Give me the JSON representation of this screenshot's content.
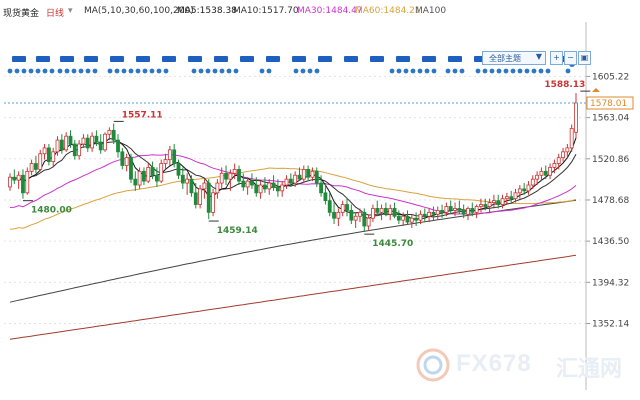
{
  "header": {
    "instrument": "现货黄金",
    "period": "日线",
    "ma_set": "MA(5,10,30,60,100,200)",
    "ma5": "MA5:1538.38",
    "ma10": "MA10:1517.70",
    "ma30": "MA30:1484.47",
    "ma60": "MA60:1484.21",
    "ma100": "MA100",
    "theme_label": "全部主题",
    "colors": {
      "period": "#cc3333",
      "ma5": "#222222",
      "ma10": "#333333",
      "ma30": "#cc33cc",
      "ma60": "#d9a23a",
      "ma100": "#555555"
    }
  },
  "watermark": {
    "brand": "FX678",
    "cn": "汇通网"
  },
  "chart_data": {
    "type": "candlestick",
    "ylim": [
      1325,
      1620
    ],
    "yticks": [
      1605.22,
      1563.04,
      1520.86,
      1478.68,
      1436.5,
      1394.32,
      1352.14
    ],
    "current_price": "1578.01",
    "annotations": [
      {
        "label": "1557.11",
        "index": 24,
        "value": 1557.11,
        "kind": "high"
      },
      {
        "label": "1480.00",
        "index": 3,
        "value": 1480.0,
        "kind": "low"
      },
      {
        "label": "1459.14",
        "index": 46,
        "value": 1459.14,
        "kind": "low"
      },
      {
        "label": "1445.70",
        "index": 82,
        "value": 1445.7,
        "kind": "low"
      },
      {
        "label": "1588.13",
        "index": 132,
        "value": 1588.13,
        "kind": "high"
      }
    ],
    "up_color": "#cc3333",
    "down_color": "#1f8a3a",
    "candles": [
      [
        1492,
        1506,
        1488,
        1502
      ],
      [
        1502,
        1510,
        1495,
        1499
      ],
      [
        1499,
        1508,
        1490,
        1504
      ],
      [
        1504,
        1510,
        1480,
        1486
      ],
      [
        1486,
        1512,
        1484,
        1508
      ],
      [
        1508,
        1520,
        1504,
        1516
      ],
      [
        1516,
        1524,
        1506,
        1510
      ],
      [
        1510,
        1530,
        1508,
        1526
      ],
      [
        1526,
        1536,
        1520,
        1532
      ],
      [
        1532,
        1536,
        1514,
        1518
      ],
      [
        1518,
        1532,
        1512,
        1528
      ],
      [
        1528,
        1544,
        1524,
        1540
      ],
      [
        1540,
        1546,
        1526,
        1530
      ],
      [
        1530,
        1548,
        1528,
        1544
      ],
      [
        1544,
        1550,
        1532,
        1536
      ],
      [
        1536,
        1540,
        1520,
        1524
      ],
      [
        1524,
        1540,
        1520,
        1536
      ],
      [
        1536,
        1546,
        1532,
        1542
      ],
      [
        1542,
        1546,
        1528,
        1532
      ],
      [
        1532,
        1548,
        1528,
        1544
      ],
      [
        1544,
        1550,
        1534,
        1538
      ],
      [
        1538,
        1546,
        1526,
        1530
      ],
      [
        1530,
        1548,
        1528,
        1546
      ],
      [
        1546,
        1553,
        1540,
        1550
      ],
      [
        1550,
        1557,
        1536,
        1540
      ],
      [
        1540,
        1546,
        1522,
        1528
      ],
      [
        1528,
        1532,
        1510,
        1514
      ],
      [
        1514,
        1526,
        1508,
        1522
      ],
      [
        1522,
        1526,
        1496,
        1500
      ],
      [
        1500,
        1508,
        1488,
        1494
      ],
      [
        1494,
        1512,
        1490,
        1508
      ],
      [
        1508,
        1512,
        1494,
        1498
      ],
      [
        1498,
        1516,
        1496,
        1512
      ],
      [
        1512,
        1518,
        1500,
        1504
      ],
      [
        1504,
        1512,
        1492,
        1498
      ],
      [
        1498,
        1520,
        1496,
        1516
      ],
      [
        1516,
        1526,
        1510,
        1520
      ],
      [
        1520,
        1534,
        1514,
        1530
      ],
      [
        1530,
        1536,
        1512,
        1516
      ],
      [
        1516,
        1520,
        1500,
        1504
      ],
      [
        1504,
        1512,
        1490,
        1496
      ],
      [
        1496,
        1506,
        1484,
        1500
      ],
      [
        1500,
        1504,
        1482,
        1486
      ],
      [
        1486,
        1496,
        1470,
        1474
      ],
      [
        1474,
        1494,
        1470,
        1490
      ],
      [
        1490,
        1500,
        1480,
        1496
      ],
      [
        1496,
        1500,
        1459,
        1466
      ],
      [
        1466,
        1490,
        1462,
        1486
      ],
      [
        1486,
        1500,
        1480,
        1496
      ],
      [
        1496,
        1512,
        1490,
        1506
      ],
      [
        1506,
        1514,
        1494,
        1500
      ],
      [
        1500,
        1510,
        1488,
        1506
      ],
      [
        1506,
        1516,
        1500,
        1510
      ],
      [
        1510,
        1514,
        1494,
        1498
      ],
      [
        1498,
        1506,
        1488,
        1492
      ],
      [
        1492,
        1502,
        1484,
        1498
      ],
      [
        1498,
        1506,
        1490,
        1494
      ],
      [
        1494,
        1502,
        1482,
        1486
      ],
      [
        1486,
        1498,
        1480,
        1494
      ],
      [
        1494,
        1502,
        1486,
        1490
      ],
      [
        1490,
        1500,
        1484,
        1496
      ],
      [
        1496,
        1504,
        1488,
        1492
      ],
      [
        1492,
        1500,
        1482,
        1488
      ],
      [
        1488,
        1498,
        1482,
        1494
      ],
      [
        1494,
        1504,
        1490,
        1500
      ],
      [
        1500,
        1506,
        1492,
        1496
      ],
      [
        1496,
        1508,
        1492,
        1504
      ],
      [
        1504,
        1512,
        1498,
        1500
      ],
      [
        1500,
        1514,
        1496,
        1510
      ],
      [
        1510,
        1514,
        1498,
        1502
      ],
      [
        1502,
        1512,
        1498,
        1508
      ],
      [
        1508,
        1512,
        1492,
        1496
      ],
      [
        1496,
        1504,
        1482,
        1486
      ],
      [
        1486,
        1496,
        1474,
        1478
      ],
      [
        1478,
        1486,
        1462,
        1466
      ],
      [
        1466,
        1476,
        1454,
        1460
      ],
      [
        1460,
        1470,
        1452,
        1466
      ],
      [
        1466,
        1478,
        1462,
        1474
      ],
      [
        1474,
        1480,
        1462,
        1468
      ],
      [
        1468,
        1474,
        1454,
        1458
      ],
      [
        1458,
        1466,
        1450,
        1462
      ],
      [
        1462,
        1470,
        1456,
        1466
      ],
      [
        1466,
        1470,
        1446,
        1452
      ],
      [
        1452,
        1464,
        1448,
        1460
      ],
      [
        1460,
        1474,
        1456,
        1470
      ],
      [
        1470,
        1478,
        1462,
        1466
      ],
      [
        1466,
        1474,
        1458,
        1470
      ],
      [
        1470,
        1476,
        1462,
        1464
      ],
      [
        1464,
        1474,
        1458,
        1470
      ],
      [
        1470,
        1476,
        1460,
        1462
      ],
      [
        1462,
        1468,
        1454,
        1458
      ],
      [
        1458,
        1466,
        1452,
        1462
      ],
      [
        1462,
        1468,
        1454,
        1456
      ],
      [
        1456,
        1464,
        1450,
        1460
      ],
      [
        1460,
        1466,
        1452,
        1458
      ],
      [
        1458,
        1468,
        1454,
        1464
      ],
      [
        1464,
        1470,
        1456,
        1462
      ],
      [
        1462,
        1470,
        1456,
        1466
      ],
      [
        1466,
        1472,
        1458,
        1464
      ],
      [
        1464,
        1472,
        1458,
        1468
      ],
      [
        1468,
        1474,
        1460,
        1466
      ],
      [
        1466,
        1476,
        1462,
        1472
      ],
      [
        1472,
        1478,
        1464,
        1468
      ],
      [
        1468,
        1476,
        1462,
        1470
      ],
      [
        1470,
        1478,
        1464,
        1468
      ],
      [
        1468,
        1474,
        1460,
        1464
      ],
      [
        1464,
        1472,
        1458,
        1470
      ],
      [
        1470,
        1476,
        1462,
        1466
      ],
      [
        1466,
        1474,
        1460,
        1472
      ],
      [
        1472,
        1480,
        1466,
        1474
      ],
      [
        1474,
        1480,
        1468,
        1472
      ],
      [
        1472,
        1480,
        1466,
        1476
      ],
      [
        1476,
        1484,
        1470,
        1478
      ],
      [
        1478,
        1484,
        1470,
        1474
      ],
      [
        1474,
        1484,
        1470,
        1480
      ],
      [
        1480,
        1486,
        1474,
        1482
      ],
      [
        1482,
        1488,
        1476,
        1480
      ],
      [
        1480,
        1490,
        1476,
        1486
      ],
      [
        1486,
        1494,
        1480,
        1490
      ],
      [
        1490,
        1496,
        1484,
        1488
      ],
      [
        1488,
        1498,
        1484,
        1494
      ],
      [
        1494,
        1504,
        1490,
        1500
      ],
      [
        1500,
        1508,
        1494,
        1504
      ],
      [
        1504,
        1512,
        1498,
        1508
      ],
      [
        1508,
        1514,
        1500,
        1504
      ],
      [
        1504,
        1516,
        1500,
        1512
      ],
      [
        1512,
        1520,
        1506,
        1516
      ],
      [
        1516,
        1526,
        1510,
        1522
      ],
      [
        1522,
        1532,
        1518,
        1528
      ],
      [
        1528,
        1536,
        1522,
        1532
      ],
      [
        1532,
        1556,
        1528,
        1552
      ],
      [
        1548,
        1588.13,
        1542,
        1578
      ]
    ]
  }
}
